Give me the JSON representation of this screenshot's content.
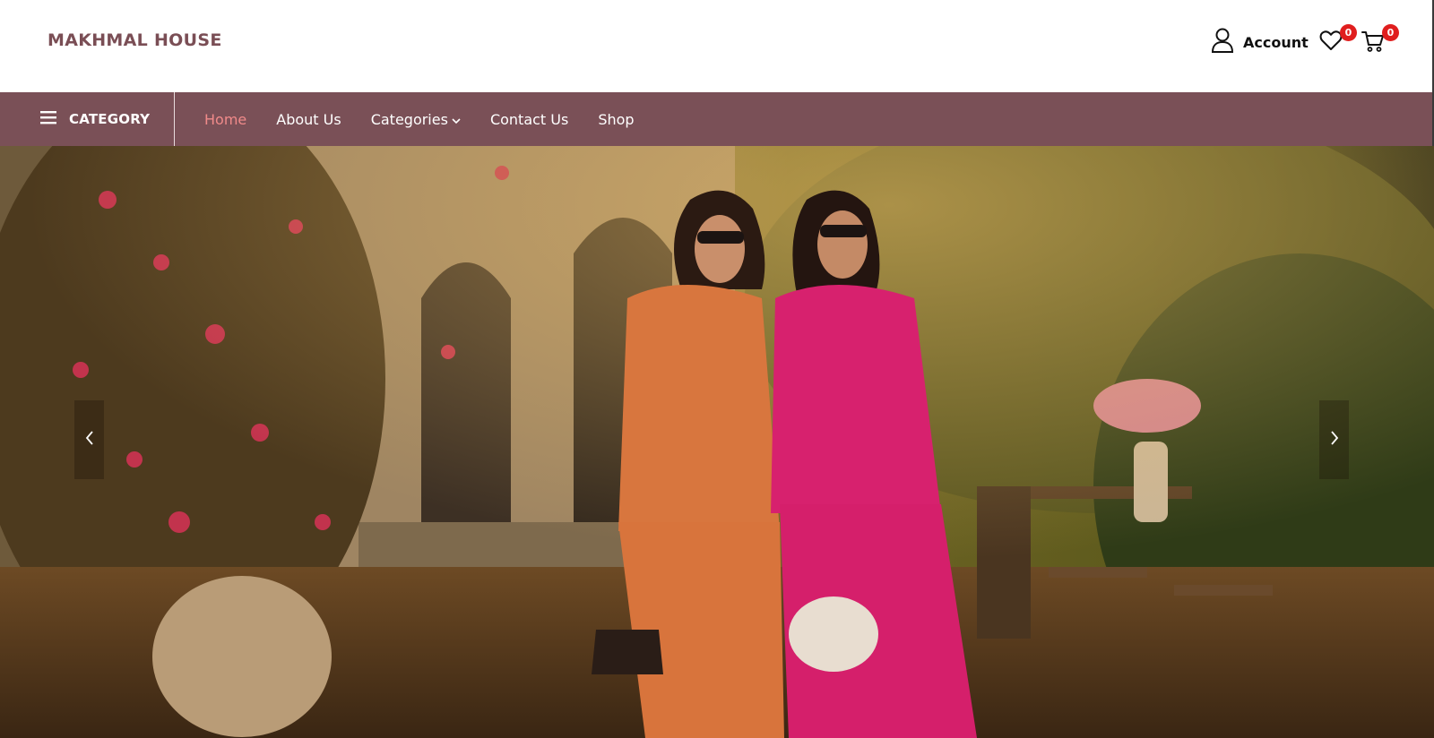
{
  "brand": {
    "name": "MAKHMAL HOUSE",
    "color": "#7a4e55"
  },
  "header": {
    "account_label": "Account",
    "account_icon": "user-icon",
    "wishlist_icon": "heart-icon",
    "wishlist_count": "0",
    "cart_icon": "cart-icon",
    "cart_count": "0",
    "badge_color": "#e01e1e"
  },
  "nav": {
    "background": "#7a5057",
    "category_toggle": {
      "icon": "hamburger-menu-icon",
      "label": "CATEGORY"
    },
    "items": [
      {
        "label": "Home",
        "active": true
      },
      {
        "label": "About Us",
        "active": false
      },
      {
        "label": "Categories",
        "active": false,
        "has_dropdown": true
      },
      {
        "label": "Contact Us",
        "active": false
      },
      {
        "label": "Shop",
        "active": false
      }
    ],
    "active_color": "#f08a8a"
  },
  "hero": {
    "image": "hero-slide-image",
    "prev_icon": "chevron-left-icon",
    "next_icon": "chevron-right-icon"
  }
}
